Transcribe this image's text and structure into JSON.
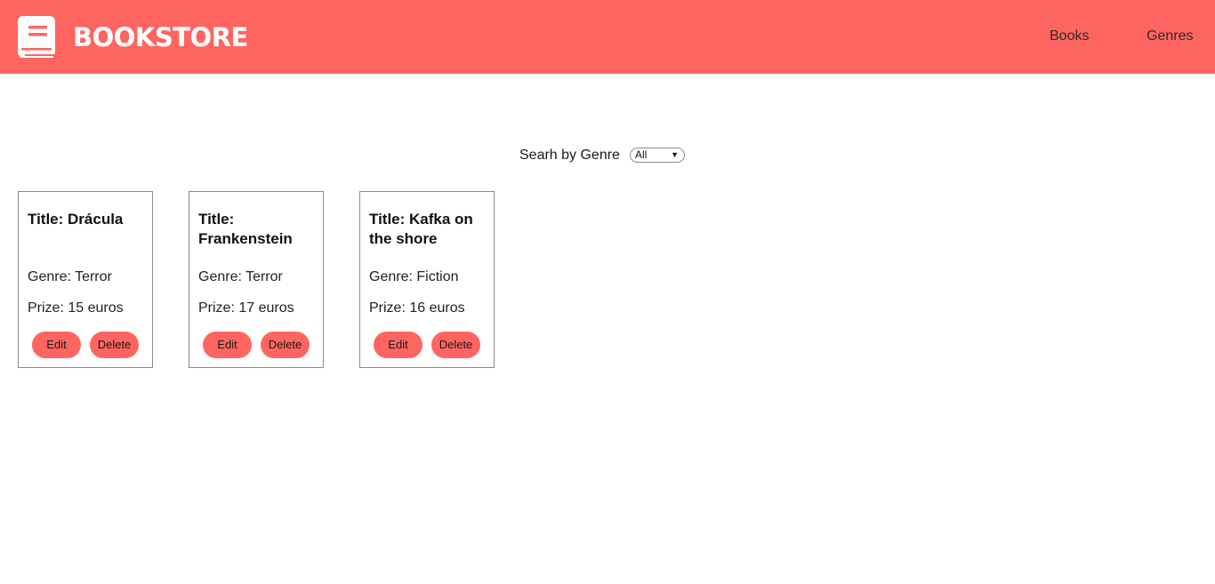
{
  "header": {
    "brand": "BOOKSTORE",
    "logo_icon": "book-icon",
    "nav": {
      "books": "Books",
      "genres": "Genres"
    },
    "background_color": "#ff6560"
  },
  "search": {
    "label": "Searh by Genre",
    "selected_genre": "All"
  },
  "books": [
    {
      "title": "Title: Drácula",
      "genre": "Genre: Terror",
      "prize": "Prize: 15 euros",
      "edit_label": "Edit",
      "delete_label": "Delete"
    },
    {
      "title": "Title: Frankenstein",
      "genre": "Genre: Terror",
      "prize": "Prize: 17 euros",
      "edit_label": "Edit",
      "delete_label": "Delete"
    },
    {
      "title": "Title: Kafka on the shore",
      "genre": "Genre: Fiction",
      "prize": "Prize: 16 euros",
      "edit_label": "Edit",
      "delete_label": "Delete"
    }
  ],
  "colors": {
    "accent": "#ff6560",
    "card_border": "#8a8a8a"
  }
}
